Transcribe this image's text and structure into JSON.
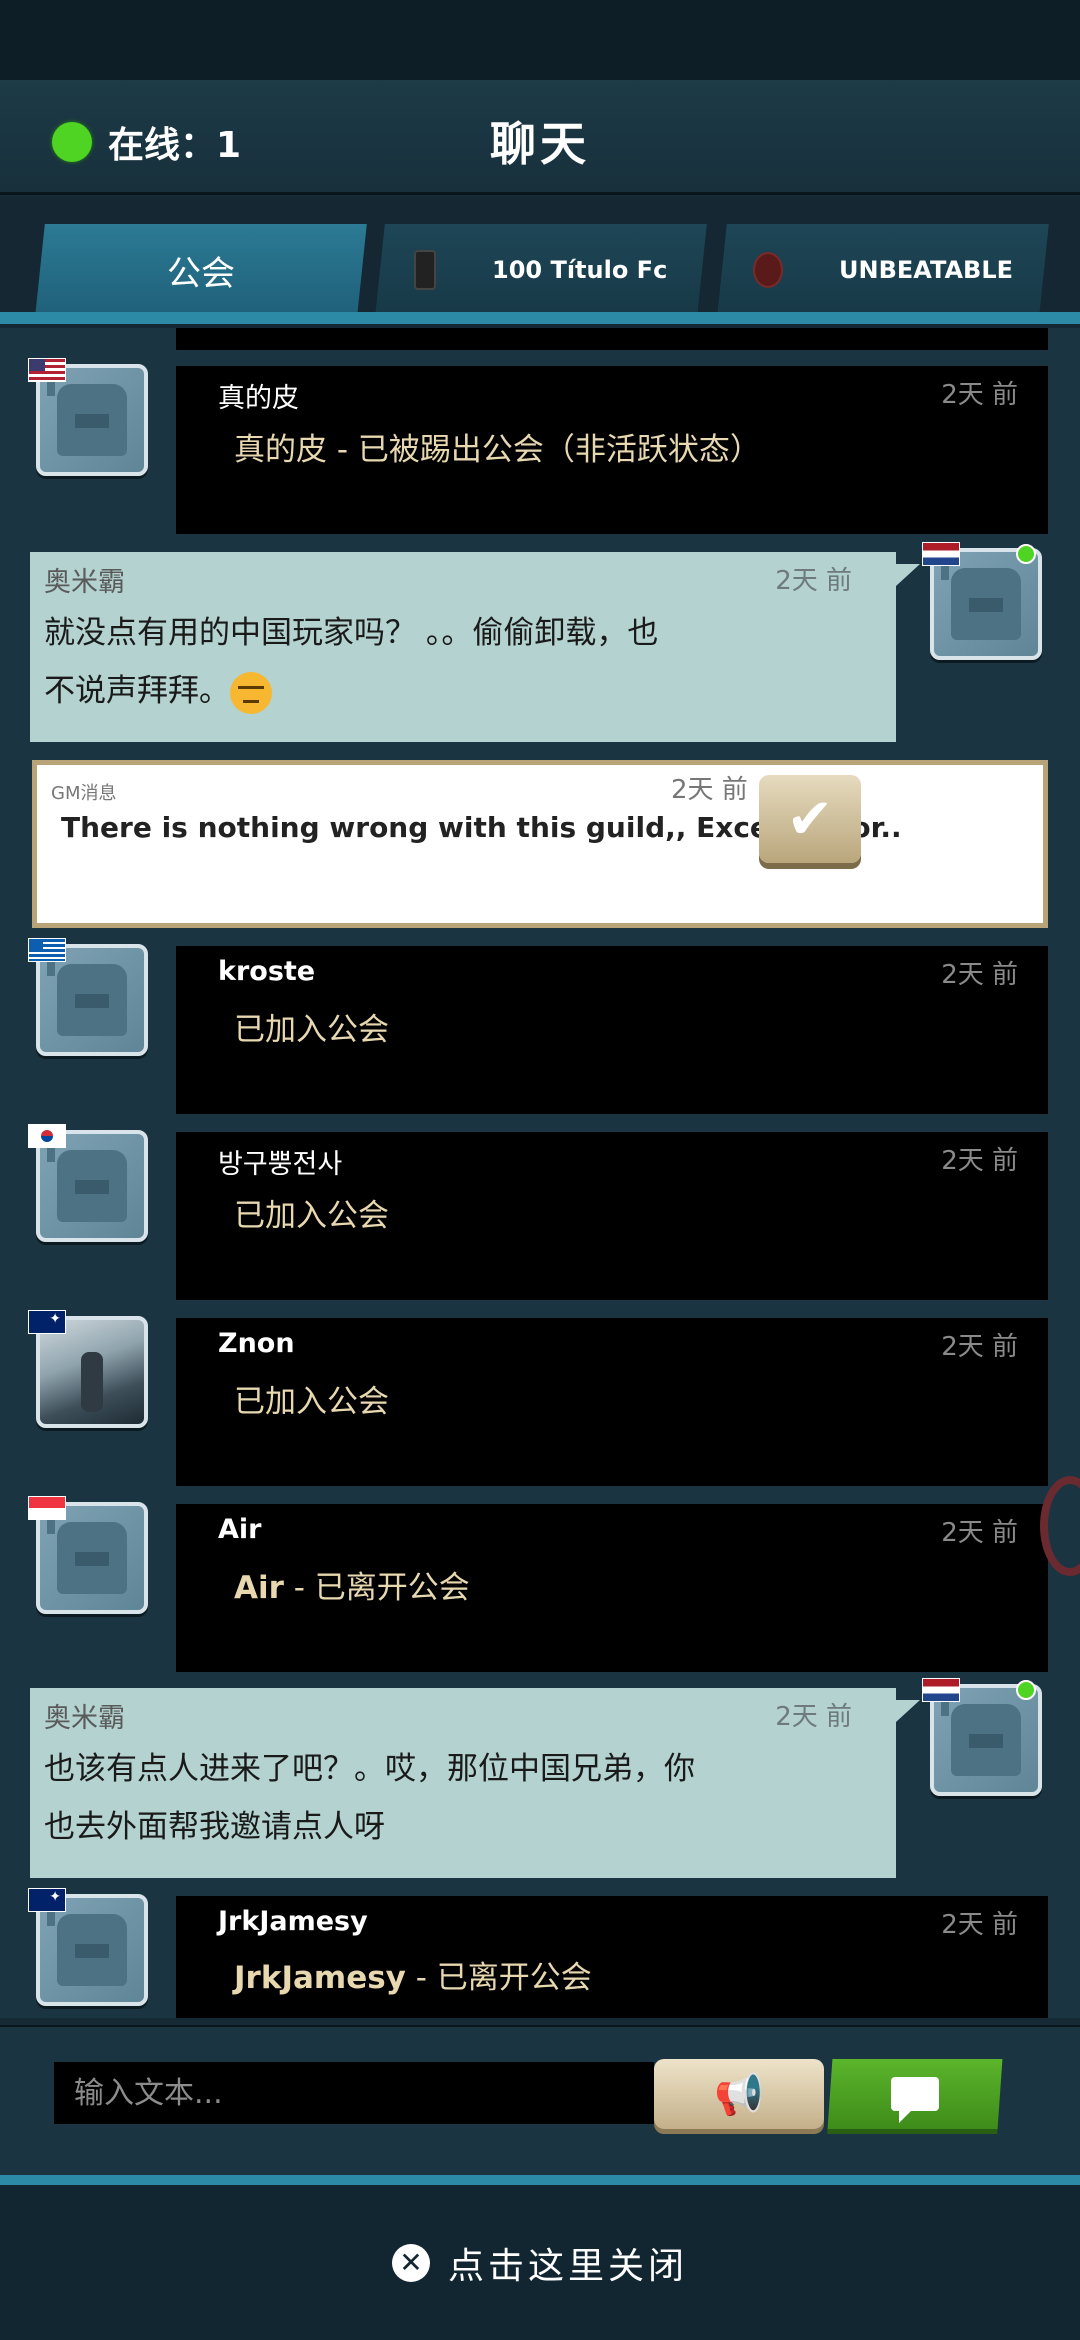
{
  "header": {
    "online_label": "在线：1",
    "title": "聊天"
  },
  "tabs": [
    {
      "label": "公会",
      "active": true
    },
    {
      "label": "100 Título Fc",
      "alert": "!"
    },
    {
      "label": "UNBEATABLE",
      "alert": "!"
    }
  ],
  "messages": {
    "m1": {
      "name": "真的皮",
      "time": "2天 前",
      "text": "真的皮 - 已被踢出公会（非活跃状态）",
      "flag": "us"
    },
    "m2": {
      "name": "奥米霸",
      "time": "2天 前",
      "text_line1": "就没点有用的中国玩家吗？ 。。偷偷卸载，也",
      "text_line2": "不说声拜拜。",
      "flag": "nl"
    },
    "gm": {
      "label": "GM消息",
      "time": "2天 前",
      "text": "There is nothing wrong with this guild,,  Except poor.."
    },
    "m4": {
      "name": "kroste",
      "time": "2天 前",
      "text": "已加入公会",
      "flag": "gr"
    },
    "m5": {
      "name": "방구뿡전사",
      "time": "2天 前",
      "text": "已加入公会",
      "flag": "kr"
    },
    "m6": {
      "name": "Znon",
      "time": "2天 前",
      "text": "已加入公会",
      "flag": "au"
    },
    "m7": {
      "name": "Air",
      "time": "2天 前",
      "text_name": "Air",
      "text": " - 已离开公会",
      "flag": "sg"
    },
    "m8": {
      "name": "奥米霸",
      "time": "2天 前",
      "text_line1": "也该有点人进来了吧？。哎，那位中国兄弟，你",
      "text_line2": "也去外面帮我邀请点人呀",
      "flag": "nl"
    },
    "m9": {
      "name": "JrkJamesy",
      "time": "2天 前",
      "text_name": "JrkJamesy",
      "text": " - 已离开公会",
      "flag": "au"
    }
  },
  "input": {
    "placeholder": "输入文本..."
  },
  "footer": {
    "close_label": "点击这里关闭"
  },
  "colors": {
    "accent": "#2c8aa6",
    "online": "#4fd423",
    "send": "#4ea323",
    "bubble": "#b3d2d0"
  }
}
